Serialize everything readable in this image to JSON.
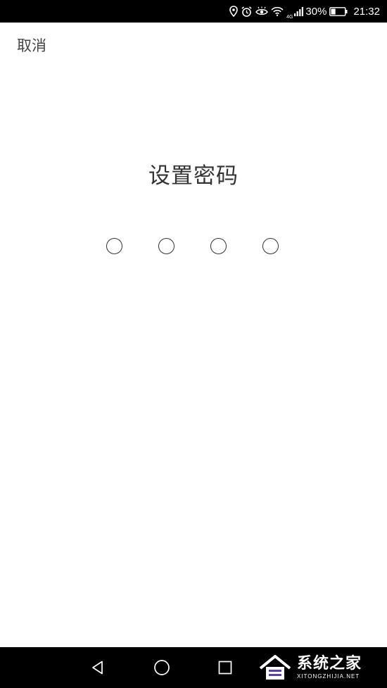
{
  "status_bar": {
    "network_label": "4G",
    "battery_percent": "30%",
    "time": "21:32",
    "icons": [
      "location-icon",
      "alarm-icon",
      "eye-comfort-icon",
      "wifi-icon",
      "signal-icon",
      "battery-icon"
    ]
  },
  "header": {
    "cancel_label": "取消"
  },
  "main": {
    "title": "设置密码",
    "pin_length": 4,
    "pin_entered": 0
  },
  "nav_bar": {
    "icons": [
      "back-icon",
      "home-icon",
      "recents-icon"
    ]
  },
  "watermark": {
    "title": "系统之家",
    "url": "XITONGZHIJIA.NET"
  }
}
